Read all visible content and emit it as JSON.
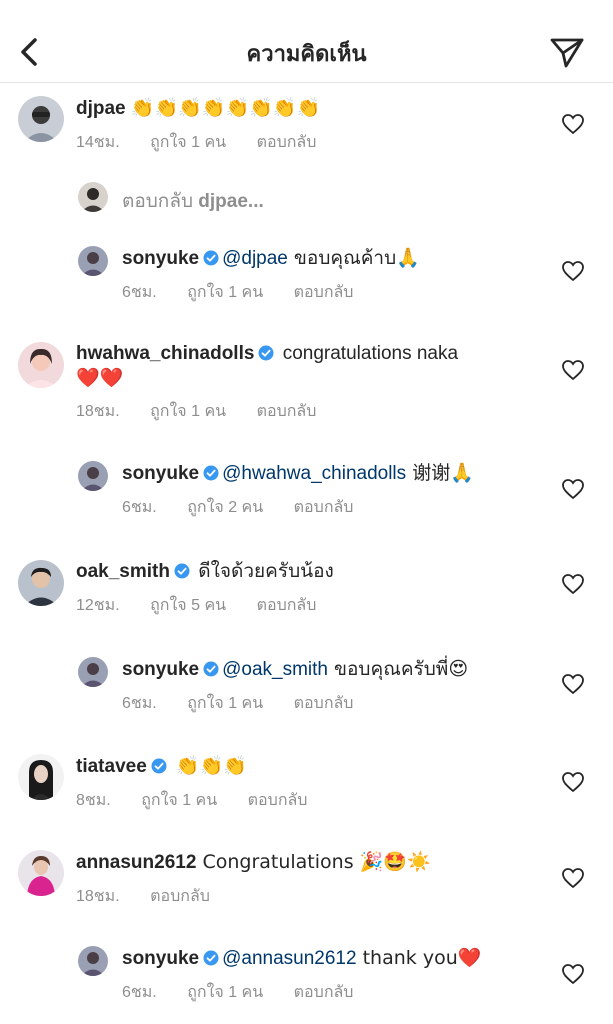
{
  "header": {
    "title": "ความคิดเห็น"
  },
  "comments": [
    {
      "username": "djpae",
      "text": "👏👏👏👏👏👏👏👏",
      "time": "14ชม.",
      "likes": "ถูกใจ 1 คน",
      "reply": "ตอบกลับ",
      "verified": false
    },
    {
      "username": "sonyuke",
      "mention": "@djpae",
      "text": " ขอบคุณค้าบ🙏",
      "time": "6ชม.",
      "likes": "ถูกใจ 1 คน",
      "reply": "ตอบกลับ",
      "verified": true
    },
    {
      "username": "hwahwa_chinadolls",
      "text": " congratulations naka",
      "text2": "❤️❤️",
      "time": "18ชม.",
      "likes": "ถูกใจ 1 คน",
      "reply": "ตอบกลับ",
      "verified": true
    },
    {
      "username": "sonyuke",
      "mention": "@hwahwa_chinadolls",
      "text": " 谢谢🙏",
      "time": "6ชม.",
      "likes": "ถูกใจ 2 คน",
      "reply": "ตอบกลับ",
      "verified": true
    },
    {
      "username": "oak_smith",
      "text": " ดีใจด้วยครับน้อง",
      "time": "12ชม.",
      "likes": "ถูกใจ 5 คน",
      "reply": "ตอบกลับ",
      "verified": true
    },
    {
      "username": "sonyuke",
      "mention": "@oak_smith",
      "text": " ขอบคุณครับพี่😍",
      "time": "6ชม.",
      "likes": "ถูกใจ 1 คน",
      "reply": "ตอบกลับ",
      "verified": true
    },
    {
      "username": "tiatavee",
      "text": " 👏👏👏",
      "time": "8ชม.",
      "likes": "ถูกใจ 1 คน",
      "reply": "ตอบกลับ",
      "verified": true
    },
    {
      "username": "annasun2612",
      "text": " Congratulations 🎉🤩☀️",
      "time": "18ชม.",
      "reply": "ตอบกลับ",
      "verified": false
    },
    {
      "username": "sonyuke",
      "mention": "@annasun2612",
      "text": " thank you❤️",
      "time": "6ชม.",
      "likes": "ถูกใจ 1 คน",
      "reply": "ตอบกลับ",
      "verified": true
    }
  ],
  "reply_prompt": {
    "prefix": "ตอบกลับ ",
    "username": "djpae..."
  },
  "colors": {
    "verified": "#3897f0",
    "mention": "#00376b",
    "meta": "#8e8e8e"
  }
}
